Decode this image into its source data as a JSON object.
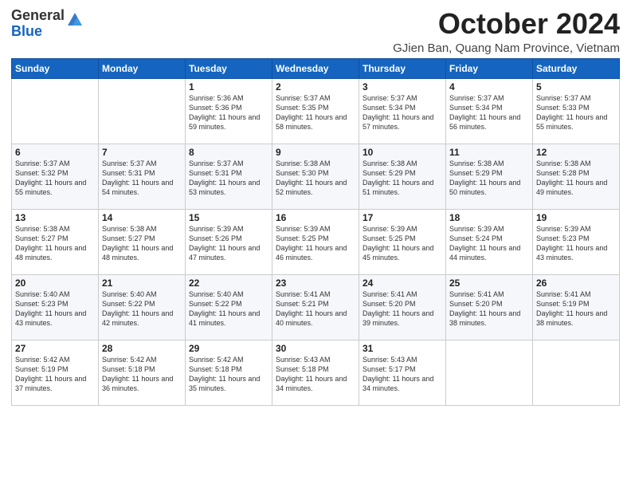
{
  "header": {
    "logo_general": "General",
    "logo_blue": "Blue",
    "month_title": "October 2024",
    "subtitle": "GJien Ban, Quang Nam Province, Vietnam"
  },
  "days_of_week": [
    "Sunday",
    "Monday",
    "Tuesday",
    "Wednesday",
    "Thursday",
    "Friday",
    "Saturday"
  ],
  "weeks": [
    [
      {
        "day": "",
        "content": ""
      },
      {
        "day": "",
        "content": ""
      },
      {
        "day": "1",
        "content": "Sunrise: 5:36 AM\nSunset: 5:36 PM\nDaylight: 11 hours and 59 minutes."
      },
      {
        "day": "2",
        "content": "Sunrise: 5:37 AM\nSunset: 5:35 PM\nDaylight: 11 hours and 58 minutes."
      },
      {
        "day": "3",
        "content": "Sunrise: 5:37 AM\nSunset: 5:34 PM\nDaylight: 11 hours and 57 minutes."
      },
      {
        "day": "4",
        "content": "Sunrise: 5:37 AM\nSunset: 5:34 PM\nDaylight: 11 hours and 56 minutes."
      },
      {
        "day": "5",
        "content": "Sunrise: 5:37 AM\nSunset: 5:33 PM\nDaylight: 11 hours and 55 minutes."
      }
    ],
    [
      {
        "day": "6",
        "content": "Sunrise: 5:37 AM\nSunset: 5:32 PM\nDaylight: 11 hours and 55 minutes."
      },
      {
        "day": "7",
        "content": "Sunrise: 5:37 AM\nSunset: 5:31 PM\nDaylight: 11 hours and 54 minutes."
      },
      {
        "day": "8",
        "content": "Sunrise: 5:37 AM\nSunset: 5:31 PM\nDaylight: 11 hours and 53 minutes."
      },
      {
        "day": "9",
        "content": "Sunrise: 5:38 AM\nSunset: 5:30 PM\nDaylight: 11 hours and 52 minutes."
      },
      {
        "day": "10",
        "content": "Sunrise: 5:38 AM\nSunset: 5:29 PM\nDaylight: 11 hours and 51 minutes."
      },
      {
        "day": "11",
        "content": "Sunrise: 5:38 AM\nSunset: 5:29 PM\nDaylight: 11 hours and 50 minutes."
      },
      {
        "day": "12",
        "content": "Sunrise: 5:38 AM\nSunset: 5:28 PM\nDaylight: 11 hours and 49 minutes."
      }
    ],
    [
      {
        "day": "13",
        "content": "Sunrise: 5:38 AM\nSunset: 5:27 PM\nDaylight: 11 hours and 48 minutes."
      },
      {
        "day": "14",
        "content": "Sunrise: 5:38 AM\nSunset: 5:27 PM\nDaylight: 11 hours and 48 minutes."
      },
      {
        "day": "15",
        "content": "Sunrise: 5:39 AM\nSunset: 5:26 PM\nDaylight: 11 hours and 47 minutes."
      },
      {
        "day": "16",
        "content": "Sunrise: 5:39 AM\nSunset: 5:25 PM\nDaylight: 11 hours and 46 minutes."
      },
      {
        "day": "17",
        "content": "Sunrise: 5:39 AM\nSunset: 5:25 PM\nDaylight: 11 hours and 45 minutes."
      },
      {
        "day": "18",
        "content": "Sunrise: 5:39 AM\nSunset: 5:24 PM\nDaylight: 11 hours and 44 minutes."
      },
      {
        "day": "19",
        "content": "Sunrise: 5:39 AM\nSunset: 5:23 PM\nDaylight: 11 hours and 43 minutes."
      }
    ],
    [
      {
        "day": "20",
        "content": "Sunrise: 5:40 AM\nSunset: 5:23 PM\nDaylight: 11 hours and 43 minutes."
      },
      {
        "day": "21",
        "content": "Sunrise: 5:40 AM\nSunset: 5:22 PM\nDaylight: 11 hours and 42 minutes."
      },
      {
        "day": "22",
        "content": "Sunrise: 5:40 AM\nSunset: 5:22 PM\nDaylight: 11 hours and 41 minutes."
      },
      {
        "day": "23",
        "content": "Sunrise: 5:41 AM\nSunset: 5:21 PM\nDaylight: 11 hours and 40 minutes."
      },
      {
        "day": "24",
        "content": "Sunrise: 5:41 AM\nSunset: 5:20 PM\nDaylight: 11 hours and 39 minutes."
      },
      {
        "day": "25",
        "content": "Sunrise: 5:41 AM\nSunset: 5:20 PM\nDaylight: 11 hours and 38 minutes."
      },
      {
        "day": "26",
        "content": "Sunrise: 5:41 AM\nSunset: 5:19 PM\nDaylight: 11 hours and 38 minutes."
      }
    ],
    [
      {
        "day": "27",
        "content": "Sunrise: 5:42 AM\nSunset: 5:19 PM\nDaylight: 11 hours and 37 minutes."
      },
      {
        "day": "28",
        "content": "Sunrise: 5:42 AM\nSunset: 5:18 PM\nDaylight: 11 hours and 36 minutes."
      },
      {
        "day": "29",
        "content": "Sunrise: 5:42 AM\nSunset: 5:18 PM\nDaylight: 11 hours and 35 minutes."
      },
      {
        "day": "30",
        "content": "Sunrise: 5:43 AM\nSunset: 5:18 PM\nDaylight: 11 hours and 34 minutes."
      },
      {
        "day": "31",
        "content": "Sunrise: 5:43 AM\nSunset: 5:17 PM\nDaylight: 11 hours and 34 minutes."
      },
      {
        "day": "",
        "content": ""
      },
      {
        "day": "",
        "content": ""
      }
    ]
  ]
}
